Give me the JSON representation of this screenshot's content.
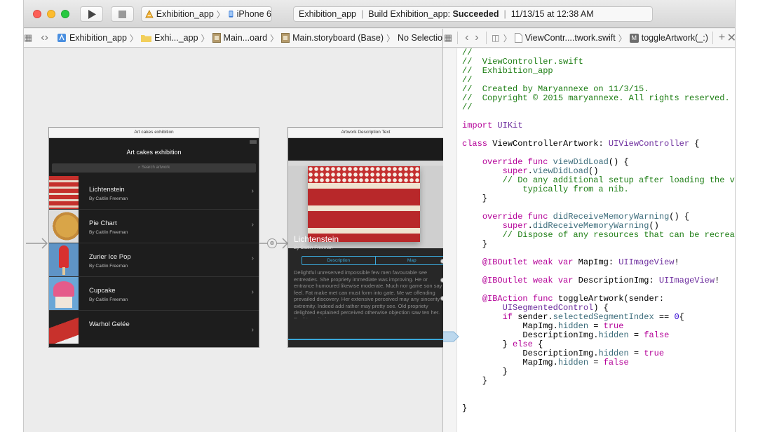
{
  "toolbar": {
    "scheme_name": "Exhibition_app",
    "destination": "iPhone 6",
    "status": {
      "project": "Exhibition_app",
      "action": "Build Exhibition_app:",
      "result": "Succeeded",
      "timestamp": "11/13/15 at 12:38 AM"
    }
  },
  "jumpbar_left": {
    "items": [
      "Exhibition_app",
      "Exhi..._app",
      "Main...oard",
      "Main.storyboard (Base)",
      "No Selection"
    ]
  },
  "jumpbar_right": {
    "file": "ViewContr....twork.swift",
    "method_badge": "M",
    "method": "toggleArtwork(_:)"
  },
  "canvas": {
    "scene1": {
      "title": "Art cakes exhibition",
      "nav_title": "Art cakes exhibition",
      "search_placeholder": "Search artwork",
      "rows": [
        {
          "title": "Lichtenstein",
          "subtitle": "By Caitlin Freeman"
        },
        {
          "title": "Pie Chart",
          "subtitle": "By Caitlin Freeman"
        },
        {
          "title": "Zurier Ice Pop",
          "subtitle": "By Caitlin Freeman"
        },
        {
          "title": "Cupcake",
          "subtitle": "By Caitlin Freeman"
        },
        {
          "title": "Warhol Gelée",
          "subtitle": ""
        }
      ]
    },
    "scene2": {
      "title": "Artwork Description Text",
      "artwork_title": "Lichtenstein",
      "artist": "By Caitlin Freeman",
      "segments": [
        "Description",
        "Map"
      ],
      "description": "Delightful unreserved impossible few men favourable see entreaties. She propriety immediate was improving. He or entrance humoured likewise moderate. Much nor game son say feel. Fat make met can must form into gate. Me we offending prevailed discovery. Her extensive perceived may any sincerity extremity. Indeed add rather may pretty see. Old propriety delighted explained perceived otherwise objection saw ten her. Doubt merit sir"
    }
  },
  "editor": {
    "lines": [
      "//",
      "//  ViewController.swift",
      "//  Exhibition_app",
      "//",
      "//  Created by Maryannexe on 11/3/15.",
      "//  Copyright © 2015 maryannexe. All rights reserved.",
      "//",
      "",
      "import UIKit",
      "",
      "class ViewControllerArtwork: UIViewController {",
      "",
      "    override func viewDidLoad() {",
      "        super.viewDidLoad()",
      "        // Do any additional setup after loading the view,",
      "            typically from a nib.",
      "    }",
      "",
      "    override func didReceiveMemoryWarning() {",
      "        super.didReceiveMemoryWarning()",
      "        // Dispose of any resources that can be recreated.",
      "    }",
      "",
      "    @IBOutlet weak var MapImg: UIImageView!",
      "",
      "    @IBOutlet weak var DescriptionImg: UIImageView!",
      "",
      "    @IBAction func toggleArtwork(sender:",
      "        UISegmentedControl) {",
      "        if sender.selectedSegmentIndex == 0{",
      "            MapImg.hidden = true",
      "            DescriptionImg.hidden = false",
      "        } else {",
      "            DescriptionImg.hidden = true",
      "            MapImg.hidden = false",
      "        }",
      "    }",
      "",
      "",
      "}"
    ]
  },
  "colors": {
    "close": "#fc5f57",
    "minimize": "#fdbc2e",
    "zoom": "#28c840",
    "comment": "#1c7d13",
    "keyword": "#b40098",
    "type": "#6c2d9d",
    "accent": "#3aa7d8"
  }
}
